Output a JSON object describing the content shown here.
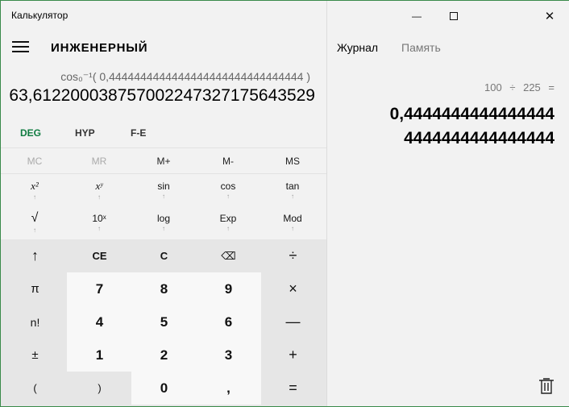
{
  "app": {
    "title": "Калькулятор",
    "mode": "ИНЖЕНЕРНЫЙ"
  },
  "display": {
    "expression": "cos₀⁻¹( 0,4444444444444444444444444444444 )",
    "result": "63,612200038757002247327175643529"
  },
  "modes": [
    "DEG",
    "HYP",
    "F-E"
  ],
  "memory": [
    "MC",
    "MR",
    "M+",
    "M-",
    "MS"
  ],
  "sci": {
    "row1": [
      "x²",
      "xʸ",
      "sin",
      "cos",
      "tan"
    ],
    "row2": [
      "√",
      "10ˣ",
      "log",
      "Exp",
      "Mod"
    ],
    "arrow": "↑"
  },
  "keys": {
    "up": "↑",
    "ce": "CE",
    "c": "C",
    "backspace": "⌫",
    "divide": "÷",
    "pi": "π",
    "seven": "7",
    "eight": "8",
    "nine": "9",
    "multiply": "×",
    "fact": "n!",
    "four": "4",
    "five": "5",
    "six": "6",
    "minus": "—",
    "plusminus": "±",
    "one": "1",
    "two": "2",
    "three": "3",
    "plus": "+",
    "lparen": "(",
    "rparen": ")",
    "zero": "0",
    "comma": ",",
    "equals": "="
  },
  "window": {
    "minimize": "—",
    "maximize": "☐",
    "close": "✕"
  },
  "history": {
    "tab_journal": "Журнал",
    "tab_memory": "Память",
    "expression": "100 ÷ 225 =",
    "result_line1": "0,4444444444444444",
    "result_line2": "4444444444444444"
  }
}
